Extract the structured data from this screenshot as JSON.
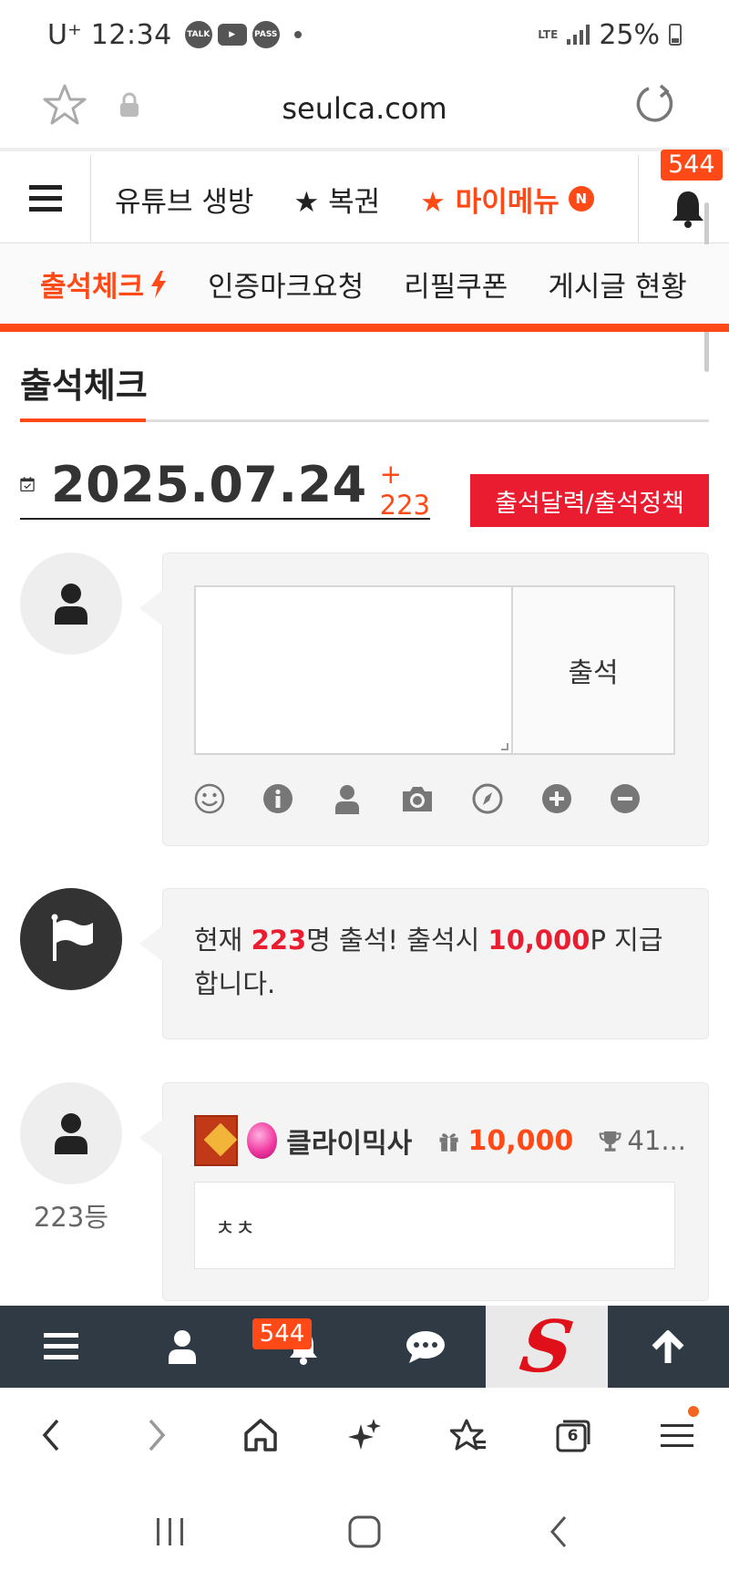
{
  "status_bar": {
    "carrier": "U⁺",
    "time": "12:34",
    "notif_icons": [
      "TALK",
      "▶",
      "PASS"
    ],
    "network": "LTE",
    "battery": "25%"
  },
  "browser": {
    "url": "seulca.com"
  },
  "top_menu": {
    "items": [
      "유튜브 생방",
      "★ 복권"
    ],
    "my_menu": "★ 마이메뉴",
    "new_badge": "N",
    "notification_count": "544"
  },
  "sub_menu": {
    "items": [
      "출석체크",
      "인증마크요청",
      "리필쿠폰",
      "게시글 현황"
    ]
  },
  "page": {
    "title": "출석체크",
    "date": "2025.07.24",
    "count_delta": "+ 223",
    "policy_button": "출석달력/출석정책"
  },
  "compose": {
    "submit_label": "출석",
    "textarea_value": ""
  },
  "notice": {
    "prefix": "현재 ",
    "count": "223",
    "middle": "명 출석! 출석시 ",
    "points": "10,000",
    "suffix": "P 지급합니다."
  },
  "entry": {
    "rank_label": "223등",
    "username": "클라이믹사",
    "points": "10,000",
    "rank_value": "41...",
    "comment": "ㅊㅊ"
  },
  "site_nav": {
    "notification_count": "544",
    "logo_letter": "S"
  },
  "browser_nav": {
    "tab_count": "6"
  },
  "colors": {
    "accent": "#ff4a17",
    "red": "#ea1c30",
    "nav_bg": "#2f3a45"
  }
}
